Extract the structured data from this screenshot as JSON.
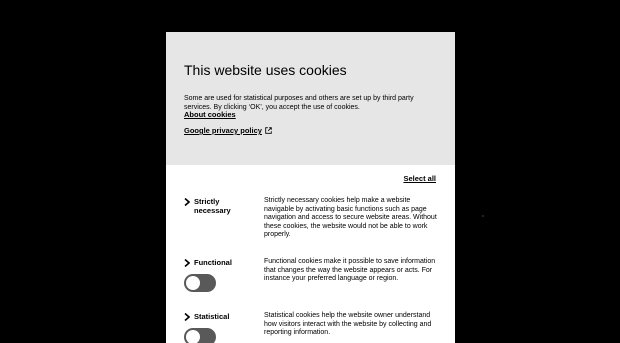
{
  "dialog": {
    "title": "This website uses cookies",
    "description": "Some are used for statistical purposes and others are set up by third party services. By clicking ‘OK’, you accept the use of cookies.",
    "about_link": "About cookies",
    "privacy_link": "Google privacy policy",
    "select_all": "Select all"
  },
  "categories": [
    {
      "label": "Strictly necessary",
      "description": "Strictly necessary cookies help make a website navigable by activating basic functions such as page navigation and access to secure website areas. Without these cookies, the website would not be able to work properly.",
      "has_toggle": false
    },
    {
      "label": "Functional",
      "description": "Functional cookies make it possible to save information that changes the way the website appears or acts. For instance your preferred language or region.",
      "has_toggle": true,
      "enabled": false
    },
    {
      "label": "Statistical",
      "description": "Statistical cookies help the website owner understand how visitors interact with the website by collecting and reporting information.",
      "has_toggle": true,
      "enabled": false
    }
  ],
  "icons": {
    "chevron": "chevron-right-icon",
    "external": "external-link-icon"
  },
  "colors": {
    "overlay": "#000000",
    "header_bg": "#e6e6e6",
    "toggle_off": "#595959"
  }
}
